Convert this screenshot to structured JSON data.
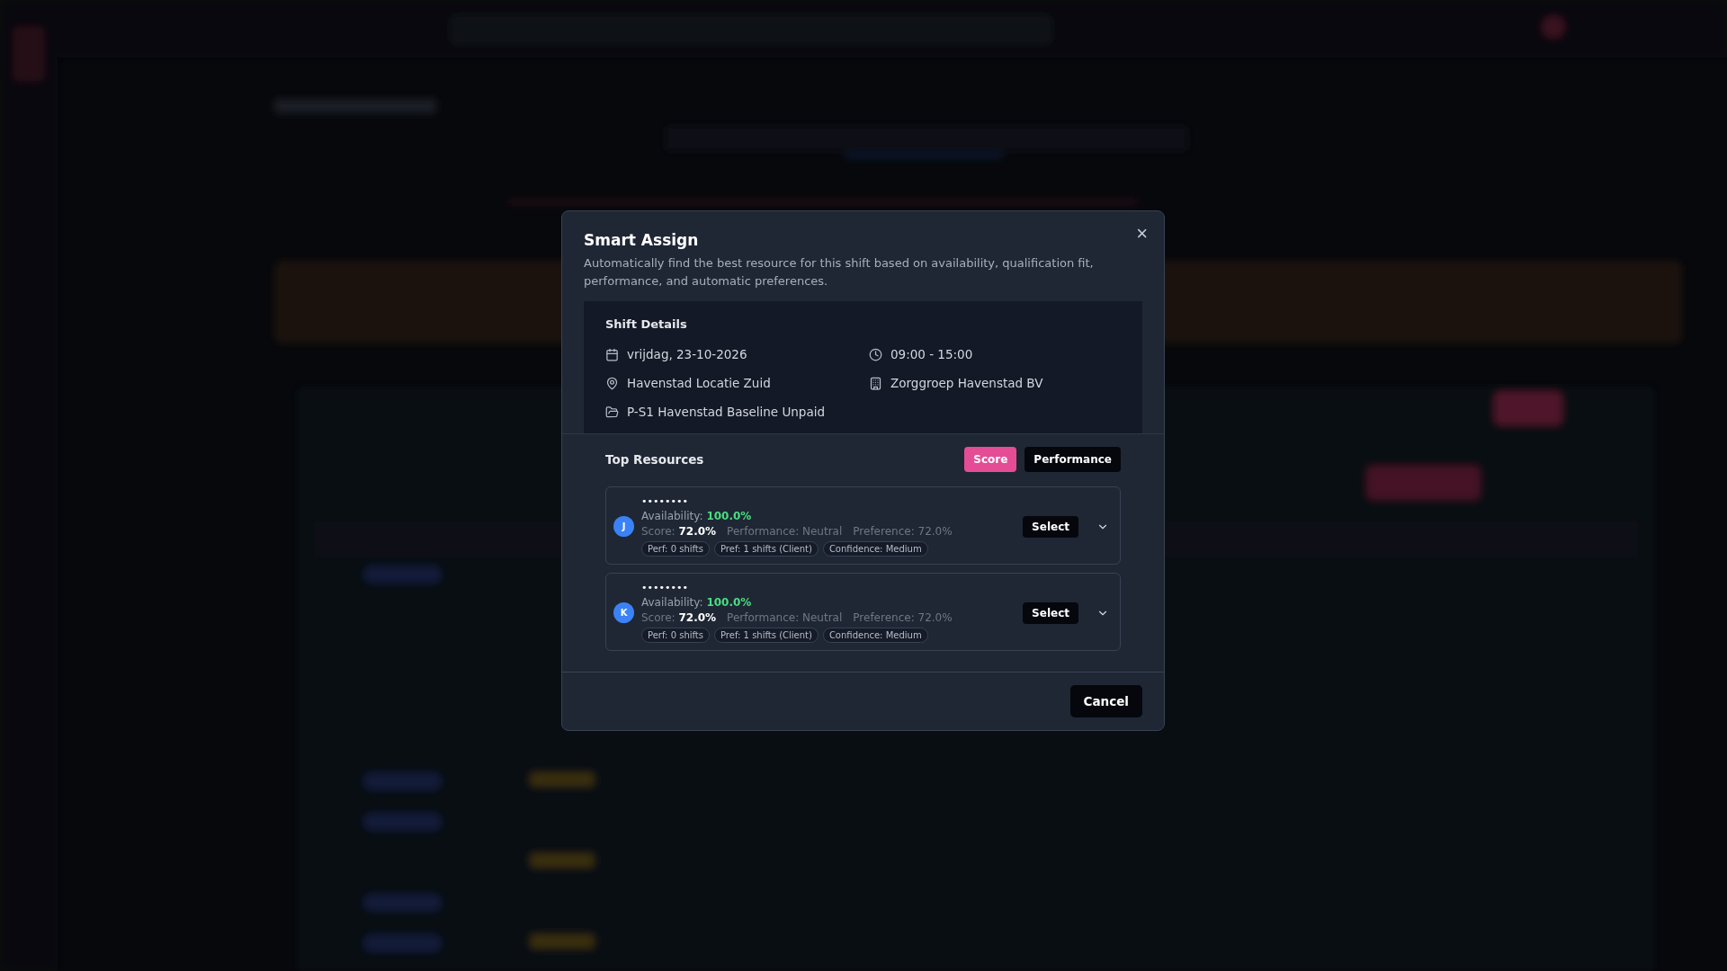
{
  "dialog": {
    "title": "Smart Assign",
    "description": "Automatically find the best resource for this shift based on availability, qualification fit, performance, and automatic preferences.",
    "close": "×",
    "shift_details": {
      "heading": "Shift Details",
      "items": [
        {
          "kind": "date",
          "text": "vrijdag, 23-10-2026"
        },
        {
          "kind": "time",
          "text": "09:00 - 15:00"
        },
        {
          "kind": "location",
          "text": "Havenstad Locatie Zuid"
        },
        {
          "kind": "client",
          "text": "Zorggroep Havenstad BV"
        },
        {
          "kind": "project",
          "text": "P-S1 Havenstad Baseline Unpaid"
        }
      ]
    },
    "top_resources": {
      "heading": "Top Resources",
      "sort_buttons": [
        {
          "label": "Score",
          "selected": true
        },
        {
          "label": "Performance",
          "selected": false
        }
      ],
      "resources": [
        {
          "initial": "J",
          "name": "••••••••",
          "availability_label": "Availability:",
          "availability": "100.0%",
          "score_label": "Score:",
          "score": "72.0%",
          "performance": "Performance: Neutral",
          "preference": "Preference: 72.0%",
          "tags": [
            "Perf: 0 shifts",
            "Pref: 1 shifts (Client)",
            "Confidence: Medium"
          ],
          "select": "Select",
          "expanded": false
        },
        {
          "initial": "K",
          "name": "••••••••",
          "availability_label": "Availability:",
          "availability": "100.0%",
          "score_label": "Score:",
          "score": "72.0%",
          "performance": "Performance: Neutral",
          "preference": "Preference: 72.0%",
          "tags": [
            "Perf: 0 shifts",
            "Pref: 1 shifts (Client)",
            "Confidence: Medium"
          ],
          "select": "Select",
          "expanded": false
        }
      ]
    },
    "cancel": "Cancel"
  }
}
